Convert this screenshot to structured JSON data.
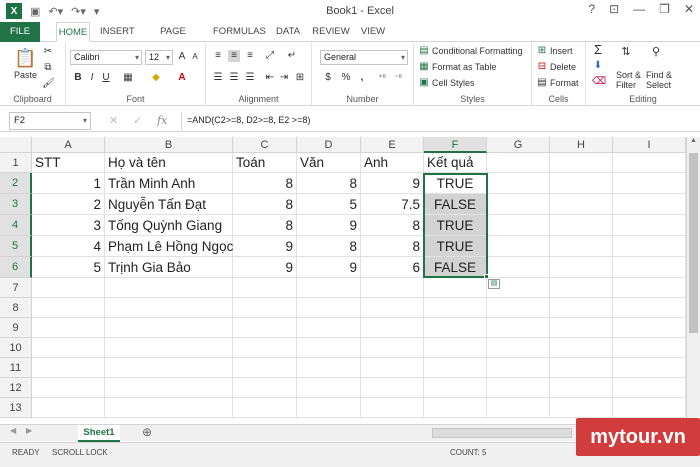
{
  "window": {
    "title": "Book1 - Excel",
    "help": "?",
    "minimize": "—",
    "restore": "❐",
    "close": "✕"
  },
  "tabs": [
    "FILE",
    "HOME",
    "INSERT",
    "PAGE LAYOUT",
    "FORMULAS",
    "DATA",
    "REVIEW",
    "VIEW"
  ],
  "ribbon": {
    "clipboard": {
      "paste": "Paste",
      "label": "Clipboard"
    },
    "font": {
      "name": "Calibri",
      "size": "12",
      "bold": "B",
      "italic": "I",
      "underline": "U",
      "label": "Font"
    },
    "alignment": {
      "label": "Alignment"
    },
    "number": {
      "format": "General",
      "currency": "$",
      "percent": "%",
      "comma": ",",
      "label": "Number"
    },
    "styles": {
      "conditional": "Conditional Formatting",
      "table": "Format as Table",
      "cell": "Cell Styles",
      "label": "Styles"
    },
    "cells": {
      "insert": "Insert",
      "delete": "Delete",
      "format": "Format",
      "label": "Cells"
    },
    "editing": {
      "sort": "Sort &",
      "filter": "Filter",
      "find": "Find &",
      "select": "Select",
      "label": "Editing"
    }
  },
  "formula_bar": {
    "name_box": "F2",
    "fx": "fx",
    "cancel": "✕",
    "enter": "✓",
    "formula": "=AND(C2>=8, D2>=8, E2 >=8)"
  },
  "columns": [
    "A",
    "B",
    "C",
    "D",
    "E",
    "F",
    "G",
    "H",
    "I"
  ],
  "rows": [
    "1",
    "2",
    "3",
    "4",
    "5",
    "6",
    "7",
    "8",
    "9",
    "10",
    "11",
    "12",
    "13"
  ],
  "header_row": [
    "STT",
    "Họ và tên",
    "Toán",
    "Văn",
    "Anh",
    "Kết quả"
  ],
  "data_rows": [
    [
      "1",
      "Trần Minh Anh",
      "8",
      "8",
      "9",
      "TRUE"
    ],
    [
      "2",
      "Nguyễn Tấn Đạt",
      "8",
      "5",
      "7.5",
      "FALSE"
    ],
    [
      "3",
      "Tống Quỳnh Giang",
      "8",
      "9",
      "8",
      "TRUE"
    ],
    [
      "4",
      "Phạm Lê Hồng Ngọc",
      "9",
      "8",
      "8",
      "TRUE"
    ],
    [
      "5",
      "Trịnh Gia Bảo",
      "9",
      "9",
      "6",
      "FALSE"
    ]
  ],
  "sheet_tabs": [
    "Sheet1"
  ],
  "add_sheet": "⊕",
  "status": {
    "ready": "READY",
    "scroll_lock": "SCROLL LOCK",
    "count": "COUNT: 5"
  },
  "watermark": "mytour.vn",
  "colors": {
    "accent": "#217346",
    "selection": "#d3d3d3",
    "watermark": "#d13d3d"
  }
}
